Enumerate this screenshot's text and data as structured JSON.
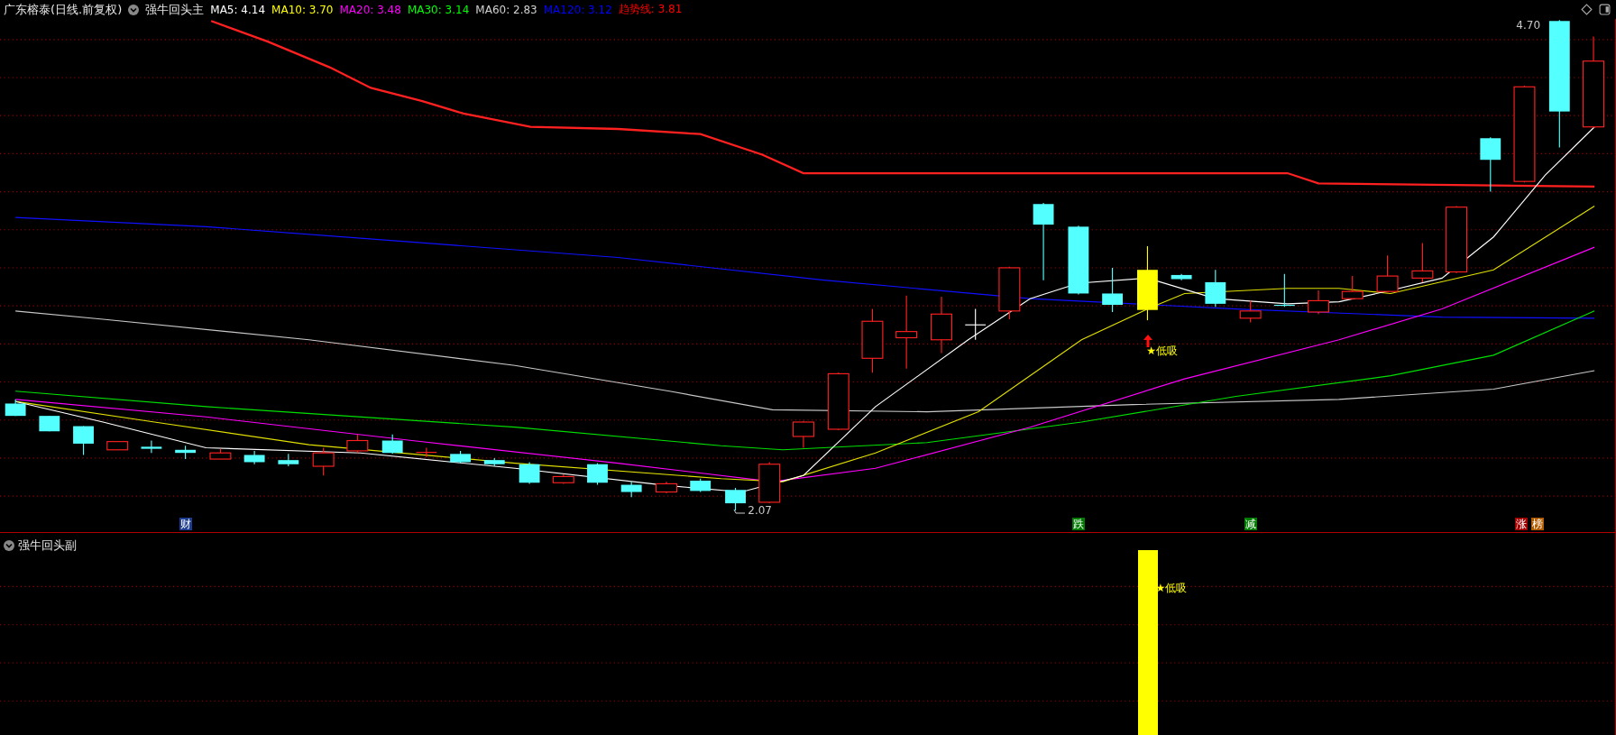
{
  "header": {
    "stock_title": "广东榕泰(日线.前复权)",
    "indicator": "强牛回头主",
    "ma_items": [
      {
        "label": "MA5:",
        "value": "4.14",
        "color": "#ffffff"
      },
      {
        "label": "MA10:",
        "value": "3.70",
        "color": "#ffff00"
      },
      {
        "label": "MA20:",
        "value": "3.48",
        "color": "#ff00ff"
      },
      {
        "label": "MA30:",
        "value": "3.14",
        "color": "#00ff00"
      },
      {
        "label": "MA60:",
        "value": "2.83",
        "color": "#d0d0d0"
      },
      {
        "label": "MA120:",
        "value": "3.12",
        "color": "#0000ff"
      },
      {
        "label": "趋势线:",
        "value": "3.81",
        "color": "#ff0000"
      }
    ]
  },
  "main_chart": {
    "high_label": "4.70",
    "low_label": "2.07",
    "buy_marker": "★低吸",
    "signals": [
      {
        "label": "财",
        "color": "#1c3d8f"
      },
      {
        "label": "跌",
        "color": "#007a00"
      },
      {
        "label": "减",
        "color": "#007a00"
      },
      {
        "label": "涨",
        "color": "#a00000"
      },
      {
        "label": "榜",
        "color": "#b05a00"
      }
    ]
  },
  "sub_panel": {
    "title": "强牛回头副",
    "marker": "★低吸"
  }
}
